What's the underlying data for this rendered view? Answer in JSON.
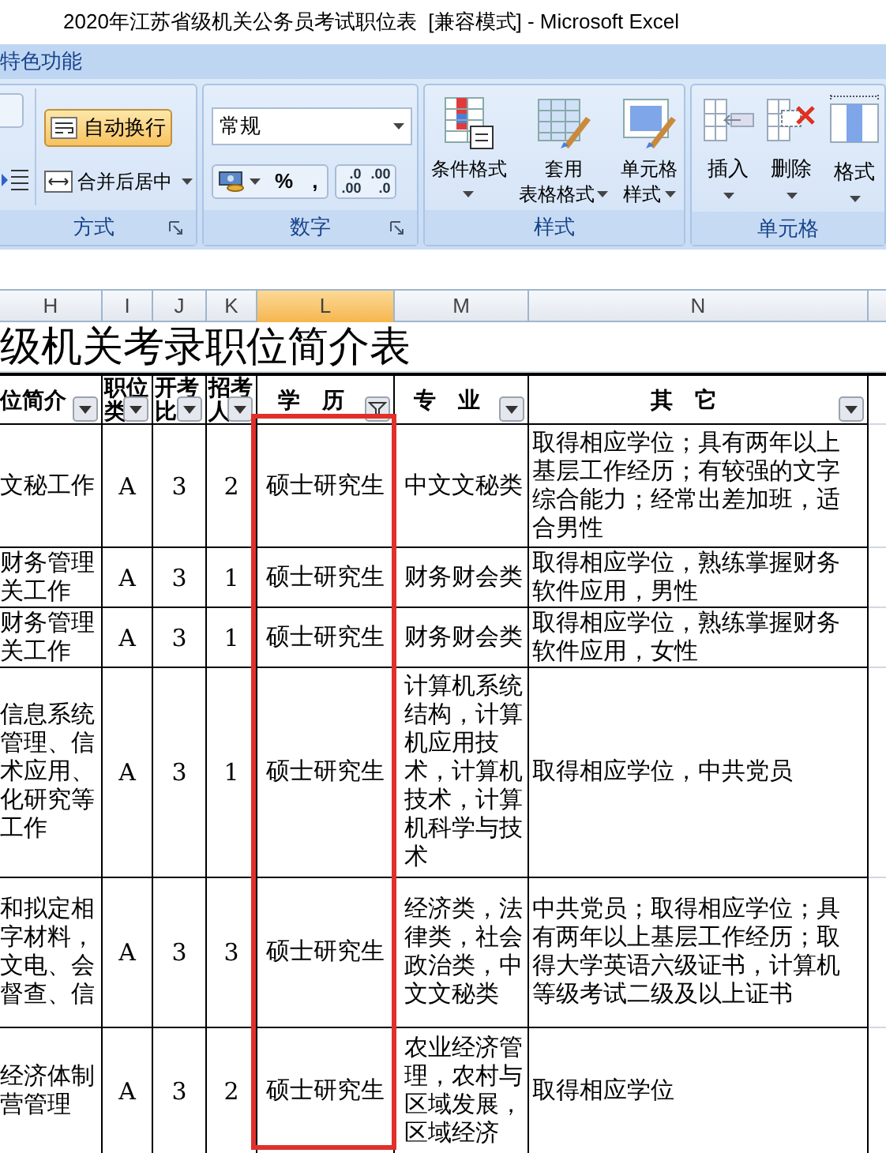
{
  "window": {
    "title": "2020年江苏省级机关公务员考试职位表  [兼容模式] - Microsoft Excel"
  },
  "ribbon": {
    "tab": "特色功能",
    "alignment": {
      "label": "方式",
      "wrap": {
        "label": "自动换行",
        "on": true
      },
      "merge": {
        "label": "合并后居中",
        "on": false
      }
    },
    "number": {
      "label": "数字",
      "format": "常规",
      "percent": "%",
      "comma": ",",
      "increase_decimal": [
        ".0",
        ".00"
      ],
      "decrease_decimal": [
        ".00",
        ".0"
      ]
    },
    "styles": {
      "label": "样式",
      "buttons": [
        {
          "kind": "conditional",
          "lines": [
            "条件格式"
          ]
        },
        {
          "kind": "table",
          "lines": [
            "套用",
            "表格格式"
          ]
        },
        {
          "kind": "cell",
          "lines": [
            "单元格",
            "样式"
          ]
        }
      ]
    },
    "cells": {
      "label": "单元格",
      "buttons": [
        {
          "kind": "insert",
          "label": "插入"
        },
        {
          "kind": "delete",
          "label": "删除"
        },
        {
          "kind": "format",
          "label": "格式"
        }
      ]
    }
  },
  "sheet": {
    "columns": [
      {
        "letter": "H",
        "selected": false
      },
      {
        "letter": "I",
        "selected": false
      },
      {
        "letter": "J",
        "selected": false
      },
      {
        "letter": "K",
        "selected": false
      },
      {
        "letter": "L",
        "selected": true
      },
      {
        "letter": "M",
        "selected": false
      },
      {
        "letter": "N",
        "selected": false
      }
    ],
    "title": "级机关考录职位简介表",
    "headers": [
      {
        "lines": [
          "位简介"
        ],
        "filtered": false
      },
      {
        "lines": [
          "职位",
          "类"
        ],
        "filtered": false
      },
      {
        "lines": [
          "开考",
          "比"
        ],
        "filtered": false
      },
      {
        "lines": [
          "招考",
          "人"
        ],
        "filtered": false
      },
      {
        "lines": [
          "学　历"
        ],
        "filtered": true
      },
      {
        "lines": [
          "专　业"
        ],
        "filtered": false
      },
      {
        "lines": [
          "其　它"
        ],
        "filtered": false
      }
    ],
    "rows": [
      {
        "cells": [
          [
            "文秘工作"
          ],
          [
            "A"
          ],
          [
            "3"
          ],
          [
            "2"
          ],
          [
            "硕士研究生"
          ],
          [
            "中文文秘类"
          ],
          [
            "取得相应学位；具有两年以上",
            "基层工作经历；有较强的文字",
            "综合能力；经常出差加班，适",
            "合男性"
          ]
        ]
      },
      {
        "cells": [
          [
            "财务管理",
            "关工作"
          ],
          [
            "A"
          ],
          [
            "3"
          ],
          [
            "1"
          ],
          [
            "硕士研究生"
          ],
          [
            "财务财会类"
          ],
          [
            "取得相应学位，熟练掌握财务",
            "软件应用，男性"
          ]
        ]
      },
      {
        "cells": [
          [
            "财务管理",
            "关工作"
          ],
          [
            "A"
          ],
          [
            "3"
          ],
          [
            "1"
          ],
          [
            "硕士研究生"
          ],
          [
            "财务财会类"
          ],
          [
            "取得相应学位，熟练掌握财务",
            "软件应用，女性"
          ]
        ]
      },
      {
        "cells": [
          [
            "信息系统",
            "管理、信",
            "术应用、",
            "化研究等",
            "工作"
          ],
          [
            "A"
          ],
          [
            "3"
          ],
          [
            "1"
          ],
          [
            "硕士研究生"
          ],
          [
            "计算机系统",
            "结构，计算",
            "机应用技",
            "术，计算机",
            "技术，计算",
            "机科学与技",
            "术"
          ],
          [
            "取得相应学位，中共党员"
          ]
        ]
      },
      {
        "cells": [
          [
            "和拟定相",
            "字材料，",
            "文电、会",
            "督查、信"
          ],
          [
            "A"
          ],
          [
            "3"
          ],
          [
            "3"
          ],
          [
            "硕士研究生"
          ],
          [
            "经济类，法",
            "律类，社会",
            "政治类，中",
            "文文秘类"
          ],
          [
            "中共党员；取得相应学位；具",
            "有两年以上基层工作经历；取",
            "得大学英语六级证书，计算机",
            "等级考试二级及以上证书"
          ]
        ]
      },
      {
        "cells": [
          [
            "经济体制",
            "营管理"
          ],
          [
            "A"
          ],
          [
            "3"
          ],
          [
            "2"
          ],
          [
            "硕士研究生"
          ],
          [
            "农业经济管",
            "理，农村与",
            "区域发展，",
            "区域经济"
          ],
          [
            "取得相应学位"
          ]
        ]
      }
    ],
    "highlight": true
  }
}
